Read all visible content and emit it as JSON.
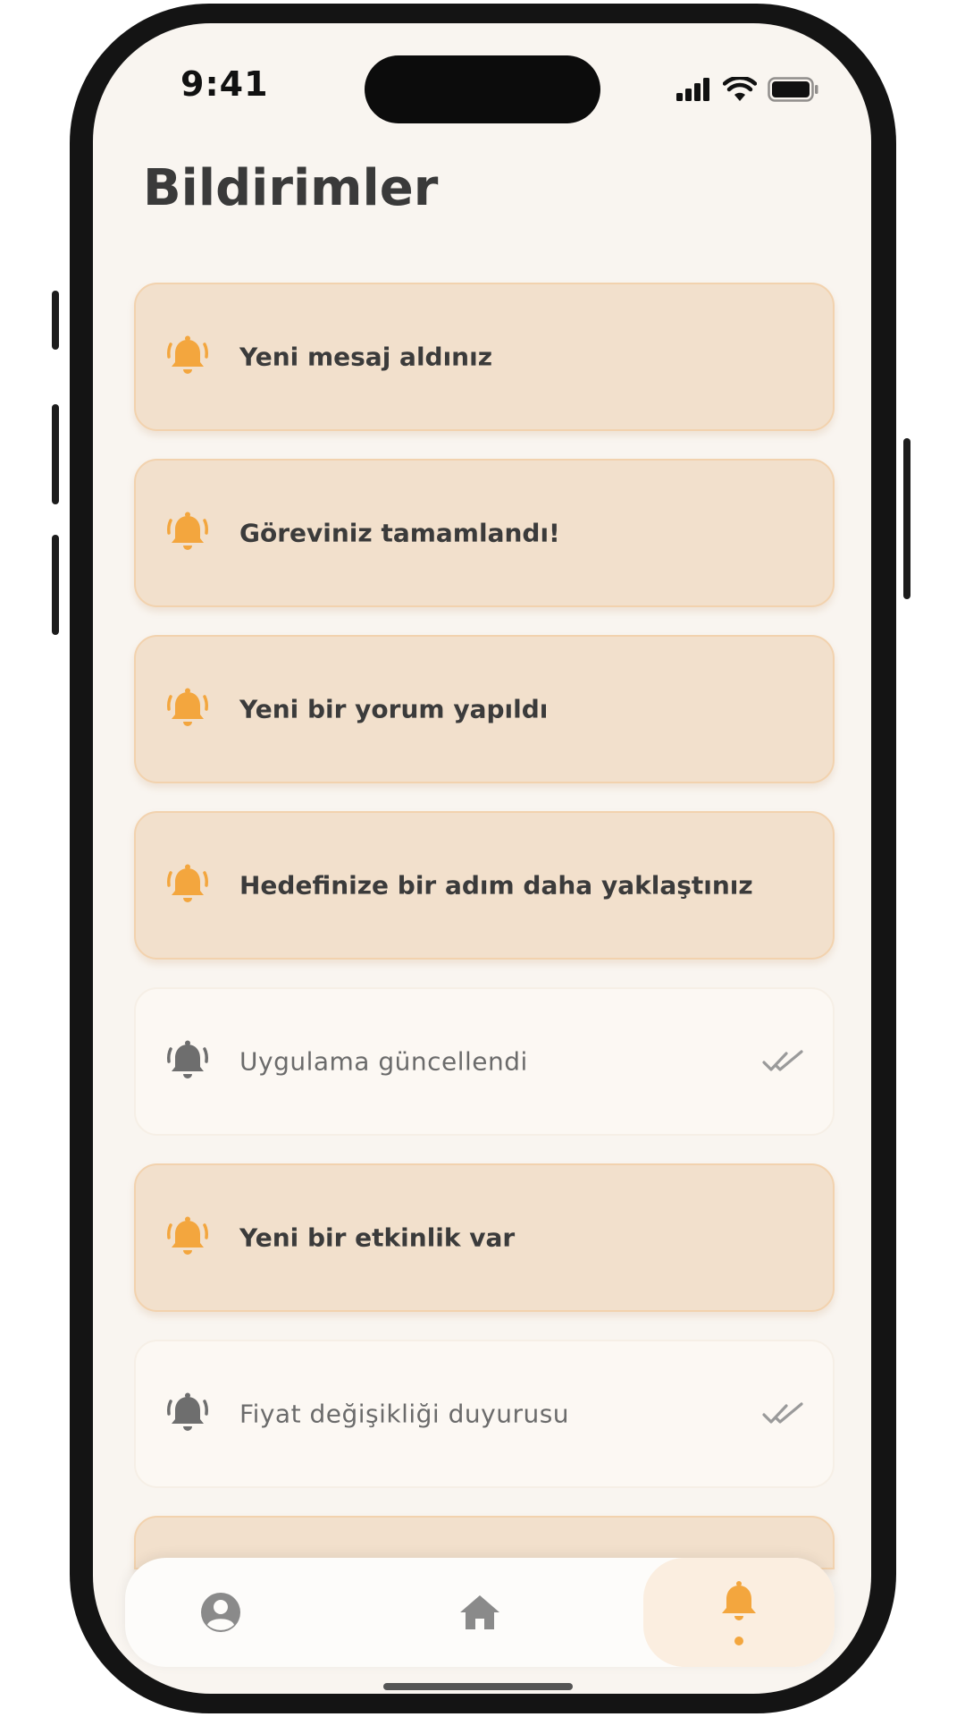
{
  "status_bar": {
    "time": "9:41"
  },
  "page": {
    "title": "Bildirimler"
  },
  "notifications": [
    {
      "text": "Yeni mesaj aldınız",
      "read": false,
      "icon": "bell-ringing-icon"
    },
    {
      "text": "Göreviniz tamamlandı!",
      "read": false,
      "icon": "bell-ringing-icon"
    },
    {
      "text": "Yeni bir yorum yapıldı",
      "read": false,
      "icon": "bell-ringing-icon"
    },
    {
      "text": "Hedefinize bir adım daha yaklaştınız",
      "read": false,
      "icon": "bell-ringing-icon"
    },
    {
      "text": "Uygulama güncellendi",
      "read": true,
      "icon": "bell-ringing-icon",
      "status_icon": "double-check-icon"
    },
    {
      "text": "Yeni bir etkinlik var",
      "read": false,
      "icon": "bell-ringing-icon"
    },
    {
      "text": "Fiyat değişikliği duyurusu",
      "read": true,
      "icon": "bell-ringing-icon",
      "status_icon": "double-check-icon"
    }
  ],
  "tab_bar": {
    "tabs": [
      {
        "name": "profile",
        "icon": "user-circle-icon",
        "active": false
      },
      {
        "name": "home",
        "icon": "home-icon",
        "active": false
      },
      {
        "name": "notifications",
        "icon": "bell-icon",
        "active": true
      }
    ]
  },
  "colors": {
    "background": "#f9f5f0",
    "unread_card": "#f2e0cc",
    "read_card": "#fcf8f3",
    "accent": "#f3a63e",
    "muted_icon": "#6e6e6e"
  }
}
